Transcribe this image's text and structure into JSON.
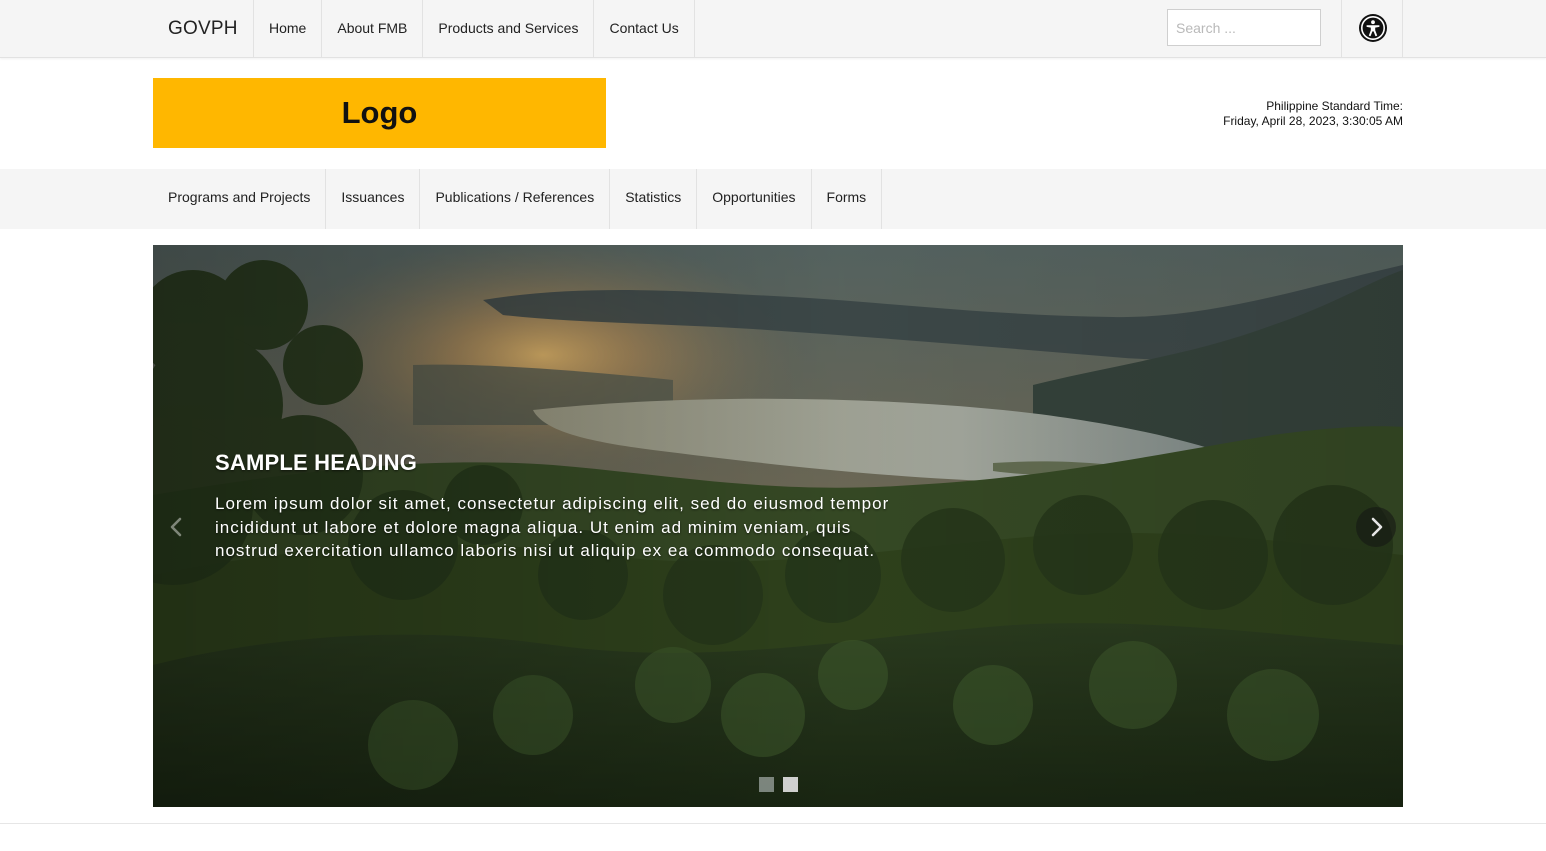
{
  "topbar": {
    "brand": "GOVPH",
    "nav": [
      {
        "label": "Home"
      },
      {
        "label": "About FMB"
      },
      {
        "label": "Products and Services"
      },
      {
        "label": "Contact Us"
      }
    ],
    "search": {
      "placeholder": "Search ...",
      "value": ""
    },
    "accessibility_icon": "accessibility-icon"
  },
  "header": {
    "logo_text": "Logo",
    "logo_color": "#ffb700",
    "pst_label": "Philippine Standard Time:",
    "pst_value": "Friday, April 28, 2023, 3:30:05 AM"
  },
  "auxnav": [
    {
      "label": "Programs and Projects"
    },
    {
      "label": "Issuances"
    },
    {
      "label": "Publications / References"
    },
    {
      "label": "Statistics"
    },
    {
      "label": "Opportunities"
    },
    {
      "label": "Forms"
    }
  ],
  "carousel": {
    "heading": "SAMPLE HEADING",
    "text": "Lorem ipsum dolor sit amet, consectetur adipiscing elit, sed do eiusmod tempor incididunt ut labore et dolore magna aliqua. Ut enim ad minim veniam, quis nostrud exercitation ullamco laboris nisi ut aliquip ex ea commodo consequat.",
    "prev_icon": "chevron-left-icon",
    "next_icon": "chevron-right-icon",
    "slides_count": 2,
    "active_slide": 1
  }
}
